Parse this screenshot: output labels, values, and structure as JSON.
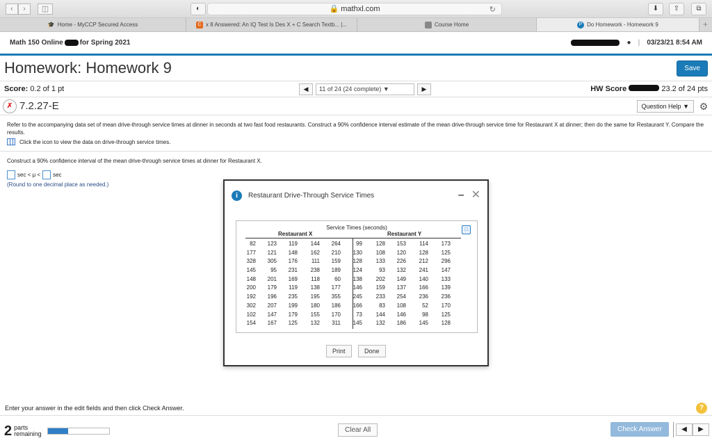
{
  "browser": {
    "url": "mathxl.com",
    "tabs": [
      {
        "label": "Home - MyCCP Secured Access",
        "icon": "graduation-cap-icon"
      },
      {
        "label": "x 8 Answered: An IQ Test Is Des X + C Search Textb... |...",
        "icon": "chegg-icon"
      },
      {
        "label": "Course Home",
        "icon": "page-icon"
      },
      {
        "label": "Do Homework - Homework 9",
        "icon": "pearson-icon"
      }
    ]
  },
  "course": {
    "title_prefix": "Math 150 Online",
    "title_suffix": "for Spring 2021",
    "datetime": "03/23/21 8:54 AM"
  },
  "homework": {
    "title": "Homework: Homework 9",
    "save_label": "Save"
  },
  "score": {
    "label": "Score:",
    "value": "0.2 of 1 pt",
    "pager_text": "11 of 24 (24 complete)",
    "hw_label": "HW Score",
    "hw_value": "23.2 of 24 pts"
  },
  "question": {
    "id": "7.2.27-E",
    "help_label": "Question Help",
    "prompt": "Refer to the accompanying data set of mean drive-through service times at dinner in seconds at two fast food restaurants. Construct a 90% confidence interval estimate of the mean drive-through service time for Restaurant X at dinner; then do the same for Restaurant Y. Compare the results.",
    "data_link": "Click the icon to view the data on drive-through service times.",
    "subprompt": "Construct a 90% confidence interval of the mean drive-through service times at dinner for Restaurant X.",
    "interval_mid": "sec < μ <",
    "interval_unit": "sec",
    "round_note": "(Round to one decimal place as needed.)"
  },
  "modal": {
    "title": "Restaurant Drive-Through Service Times",
    "table_title": "Service Times (seconds)",
    "group_x": "Restaurant X",
    "group_y": "Restaurant Y",
    "rows": [
      [
        "82",
        "123",
        "119",
        "144",
        "264",
        "99",
        "128",
        "153",
        "114",
        "173"
      ],
      [
        "177",
        "121",
        "148",
        "162",
        "210",
        "130",
        "108",
        "120",
        "128",
        "125"
      ],
      [
        "328",
        "305",
        "176",
        "111",
        "159",
        "128",
        "133",
        "226",
        "212",
        "296"
      ],
      [
        "145",
        "95",
        "231",
        "238",
        "189",
        "124",
        "93",
        "132",
        "241",
        "147"
      ],
      [
        "148",
        "201",
        "169",
        "118",
        "60",
        "138",
        "202",
        "149",
        "140",
        "133"
      ],
      [
        "200",
        "179",
        "119",
        "138",
        "177",
        "146",
        "159",
        "137",
        "166",
        "139"
      ],
      [
        "192",
        "196",
        "235",
        "195",
        "355",
        "245",
        "233",
        "254",
        "236",
        "236"
      ],
      [
        "302",
        "207",
        "199",
        "180",
        "186",
        "166",
        "83",
        "108",
        "52",
        "170"
      ],
      [
        "102",
        "147",
        "179",
        "155",
        "170",
        "73",
        "144",
        "146",
        "98",
        "125"
      ],
      [
        "154",
        "167",
        "125",
        "132",
        "311",
        "145",
        "132",
        "186",
        "145",
        "128"
      ]
    ],
    "print_label": "Print",
    "done_label": "Done"
  },
  "footer": {
    "instruction": "Enter your answer in the edit fields and then click Check Answer.",
    "parts_count": "2",
    "parts_label_1": "parts",
    "parts_label_2": "remaining",
    "progress_fraction": 0.33,
    "clear_label": "Clear All",
    "check_label": "Check Answer"
  },
  "colors": {
    "accent": "#1a7bb8",
    "check_disabled": "#93b9dc"
  }
}
